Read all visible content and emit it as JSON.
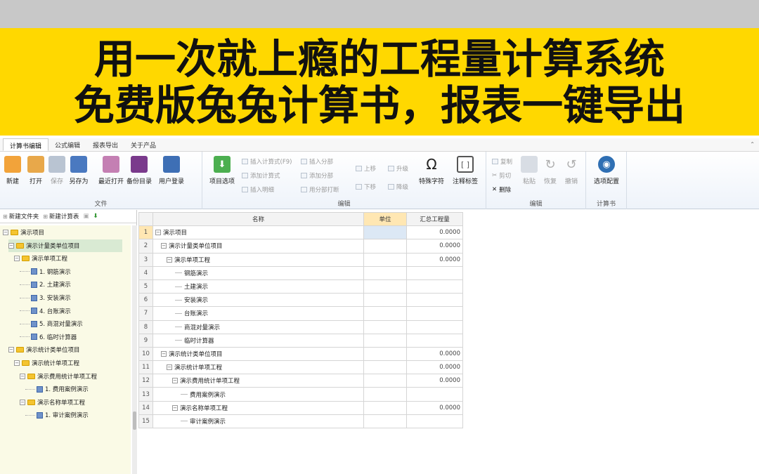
{
  "banner": {
    "line1": "用一次就上瘾的工程量计算系统",
    "line2": "免费版兔兔计算书，报表一键导出"
  },
  "tabs": [
    "计算书编辑",
    "公式编辑",
    "报表导出",
    "关于产品"
  ],
  "ribbon": {
    "file_group": {
      "label": "文件",
      "buttons": [
        {
          "label": "新建",
          "icon": "new-icon",
          "color": "#f2a33a"
        },
        {
          "label": "打开",
          "icon": "open-icon",
          "color": "#e8a84a"
        },
        {
          "label": "保存",
          "icon": "save-icon",
          "color": "#b9c4d2"
        },
        {
          "label": "另存为",
          "icon": "save-as-icon",
          "color": "#4a79c0"
        },
        {
          "label": "最近打开",
          "icon": "recent-icon",
          "color": "#c47fb3"
        },
        {
          "label": "备份目录",
          "icon": "backup-icon",
          "color": "#7a3a8c"
        },
        {
          "label": "用户登录",
          "icon": "user-icon",
          "color": "#3e6fb5"
        }
      ]
    },
    "edit_group": {
      "label": "编辑",
      "project_option": "项目选项",
      "insert_formula": "插入计算式(F9)",
      "add_formula": "添加计算式",
      "insert_detail": "插入明细",
      "insert_part": "插入分部",
      "add_part": "添加分部",
      "all_part_print": "用分部打断",
      "move_up": "上移",
      "move_down": "下移",
      "upgrade": "升级",
      "downgrade": "降级",
      "special_char": "特殊字符",
      "annotation": "注释标签"
    },
    "edit_group2": {
      "label": "编辑",
      "copy": "复制",
      "cut": "剪切",
      "delete": "删除",
      "paste": "粘贴",
      "redo": "恢复",
      "undo": "撤销"
    },
    "calc_group": {
      "label": "计算书",
      "option_config": "选项配置"
    }
  },
  "left_panel": {
    "new_folder": "新建文件夹",
    "new_calc": "新建计算表",
    "tree": [
      {
        "label": "演示项目",
        "type": "folder",
        "level": 0
      },
      {
        "label": "演示计量类单位项目",
        "type": "folder",
        "level": 1,
        "selected": true
      },
      {
        "label": "演示单项工程",
        "type": "folder",
        "level": 2
      },
      {
        "label": "1. 钢筋演示",
        "type": "doc",
        "level": 3
      },
      {
        "label": "2. 土建演示",
        "type": "doc",
        "level": 3
      },
      {
        "label": "3. 安装演示",
        "type": "doc",
        "level": 3
      },
      {
        "label": "4. 台账演示",
        "type": "doc",
        "level": 3
      },
      {
        "label": "5. 商混对量演示",
        "type": "doc",
        "level": 3
      },
      {
        "label": "6. 临时计算器",
        "type": "doc",
        "level": 3
      },
      {
        "label": "演示统计类单位项目",
        "type": "folder",
        "level": 1
      },
      {
        "label": "演示统计单项工程",
        "type": "folder",
        "level": 2
      },
      {
        "label": "演示费用统计单项工程",
        "type": "folder",
        "level": 3
      },
      {
        "label": "1. 费用案例演示",
        "type": "doc",
        "level": 4
      },
      {
        "label": "演示名称单项工程",
        "type": "folder",
        "level": 3
      },
      {
        "label": "1. 审计案例演示",
        "type": "doc",
        "level": 4
      }
    ]
  },
  "grid": {
    "headers": {
      "name": "名称",
      "unit": "单位",
      "total": "汇总工程量"
    },
    "rows": [
      {
        "idx": "1",
        "name": "演示项目",
        "level": 0,
        "exp": true,
        "unit": "",
        "total": "0.0000"
      },
      {
        "idx": "2",
        "name": "演示计量类单位项目",
        "level": 1,
        "exp": true,
        "unit": "",
        "total": "0.0000"
      },
      {
        "idx": "3",
        "name": "演示单项工程",
        "level": 2,
        "exp": true,
        "unit": "",
        "total": "0.0000"
      },
      {
        "idx": "4",
        "name": "钢筋演示",
        "level": 3,
        "exp": false,
        "unit": "",
        "total": ""
      },
      {
        "idx": "5",
        "name": "土建演示",
        "level": 3,
        "exp": false,
        "unit": "",
        "total": ""
      },
      {
        "idx": "6",
        "name": "安装演示",
        "level": 3,
        "exp": false,
        "unit": "",
        "total": ""
      },
      {
        "idx": "7",
        "name": "台账演示",
        "level": 3,
        "exp": false,
        "unit": "",
        "total": ""
      },
      {
        "idx": "8",
        "name": "商混对量演示",
        "level": 3,
        "exp": false,
        "unit": "",
        "total": ""
      },
      {
        "idx": "9",
        "name": "临时计算器",
        "level": 3,
        "exp": false,
        "unit": "",
        "total": ""
      },
      {
        "idx": "10",
        "name": "演示统计类单位项目",
        "level": 1,
        "exp": true,
        "unit": "",
        "total": "0.0000"
      },
      {
        "idx": "11",
        "name": "演示统计单项工程",
        "level": 2,
        "exp": true,
        "unit": "",
        "total": "0.0000"
      },
      {
        "idx": "12",
        "name": "演示费用统计单项工程",
        "level": 3,
        "exp": true,
        "unit": "",
        "total": "0.0000"
      },
      {
        "idx": "13",
        "name": "费用案例演示",
        "level": 4,
        "exp": false,
        "unit": "",
        "total": ""
      },
      {
        "idx": "14",
        "name": "演示名称单项工程",
        "level": 3,
        "exp": true,
        "unit": "",
        "total": "0.0000"
      },
      {
        "idx": "15",
        "name": "审计案例演示",
        "level": 4,
        "exp": false,
        "unit": "",
        "total": ""
      }
    ]
  }
}
